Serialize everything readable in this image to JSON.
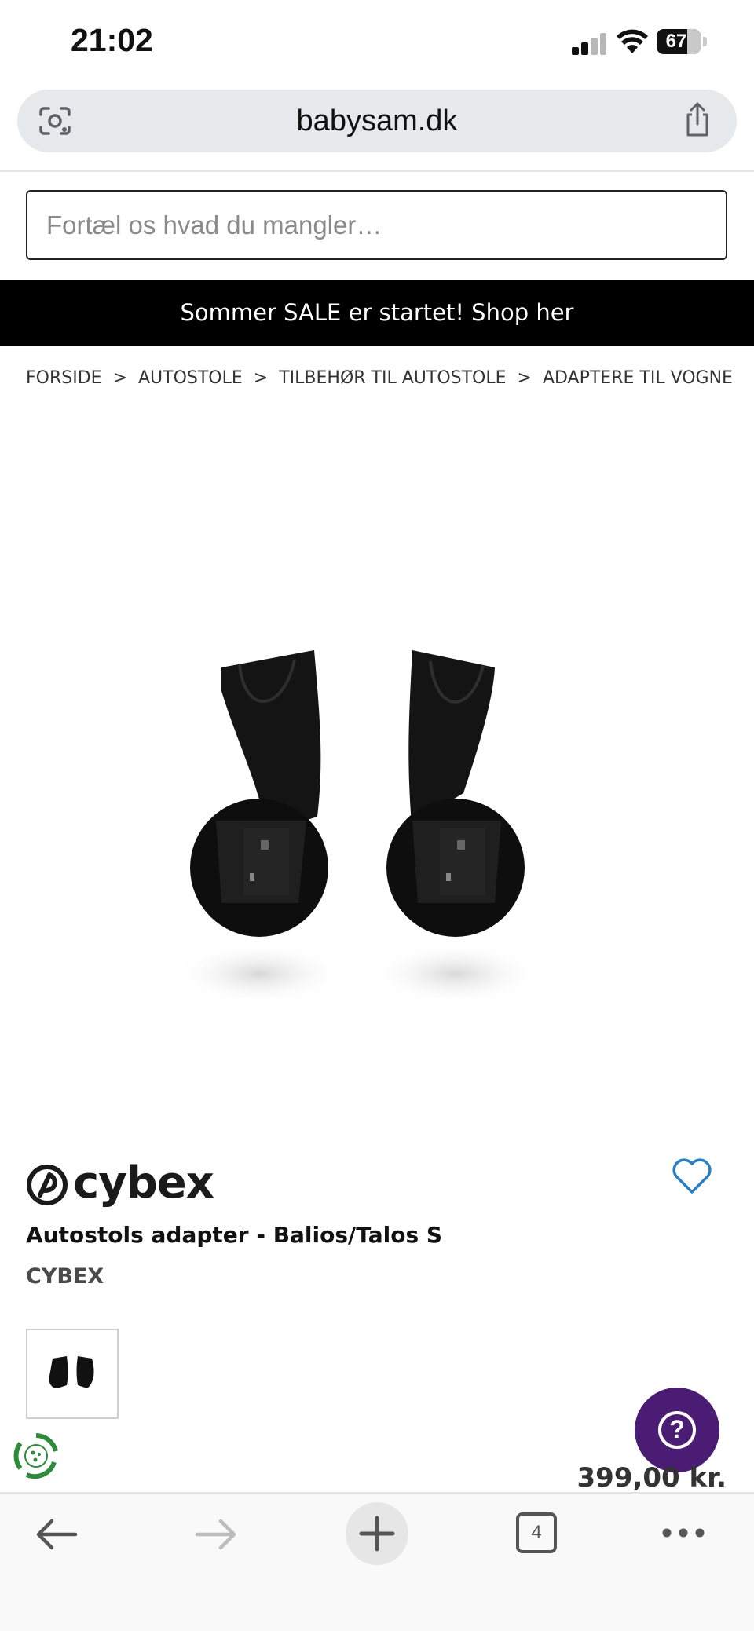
{
  "status_bar": {
    "time": "21:02",
    "battery": "67"
  },
  "browser": {
    "url": "babysam.dk",
    "tab_count": "4"
  },
  "search": {
    "placeholder": "Fortæl os hvad du mangler…"
  },
  "promo": {
    "text": "Sommer SALE er startet! Shop her"
  },
  "breadcrumb": {
    "items": [
      "FORSIDE",
      "AUTOSTOLE",
      "TILBEHØR TIL AUTOSTOLE",
      "ADAPTERE TIL VOGNE"
    ],
    "separator": ">"
  },
  "product": {
    "brand_logo_text": "cybex",
    "title": "Autostols adapter - Balios/Talos S",
    "brand": "CYBEX",
    "price": "399,00 kr."
  },
  "help": {
    "label": "?"
  },
  "colors": {
    "promo_bg": "#000000",
    "help_bg": "#4b1c73",
    "favorite": "#2a7fc4",
    "eco": "#2e8b3a"
  }
}
